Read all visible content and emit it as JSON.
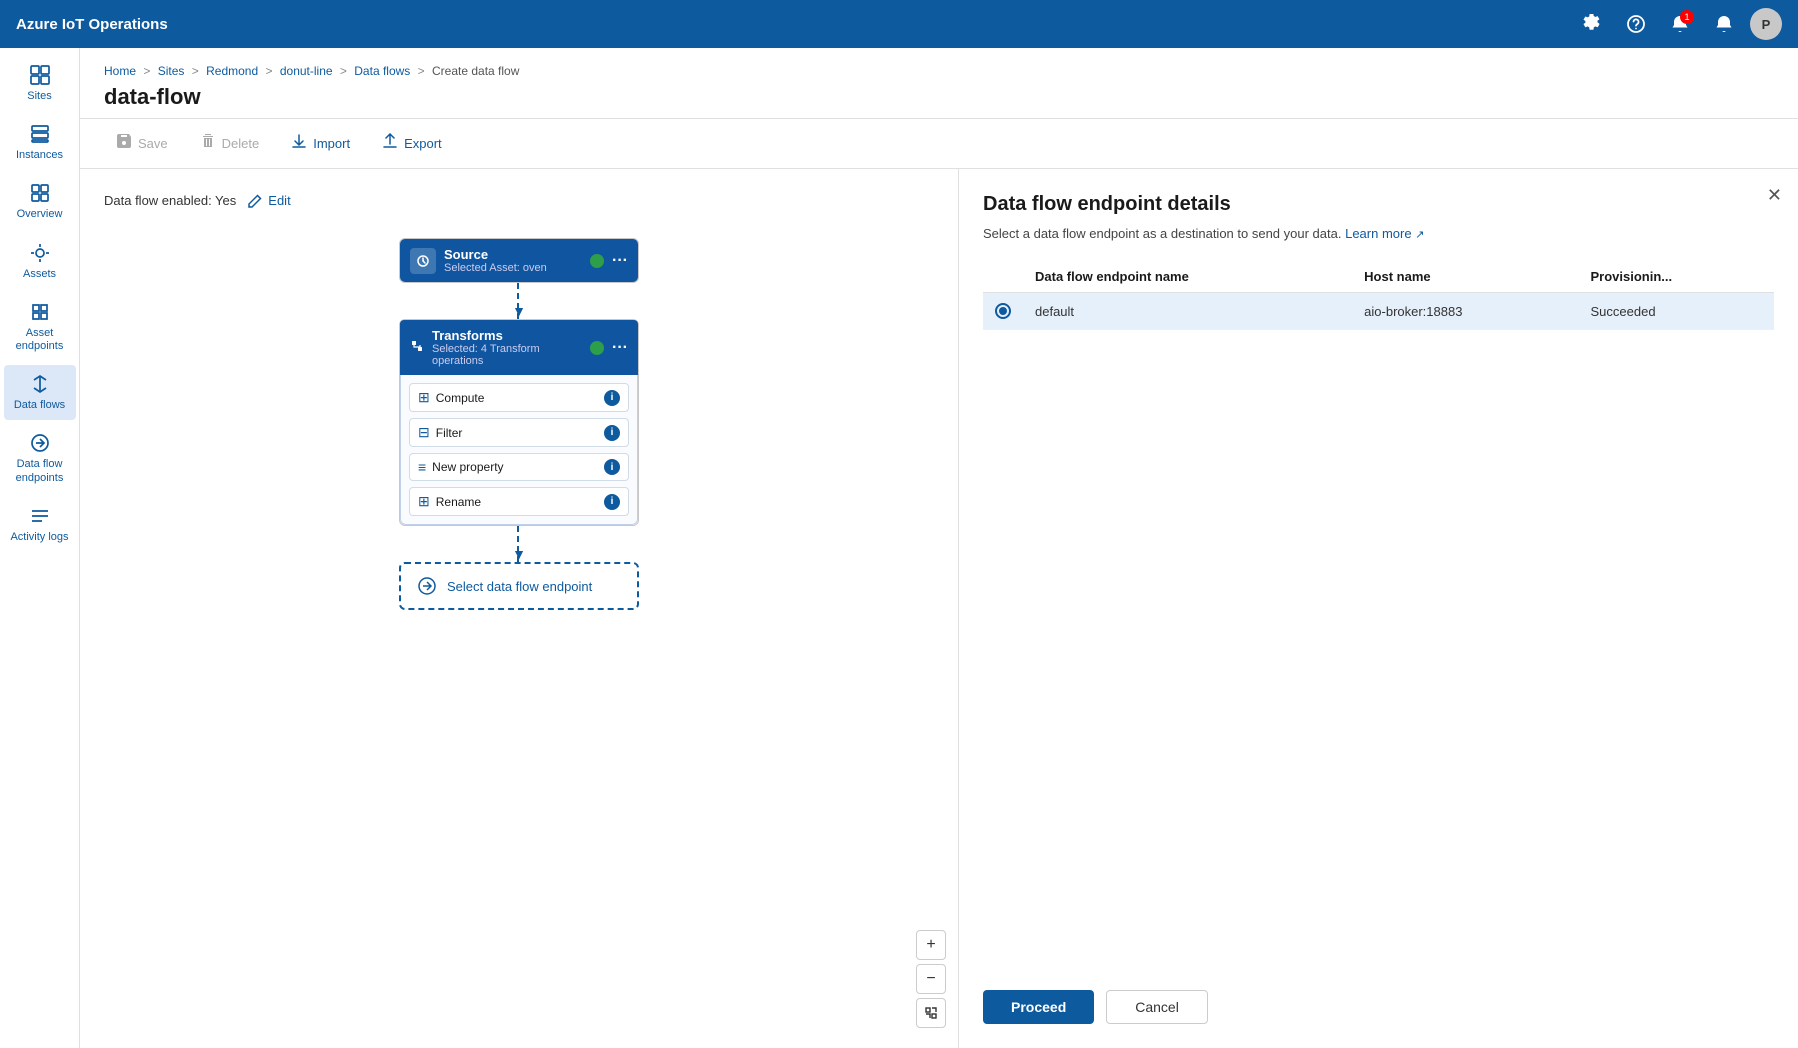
{
  "app": {
    "title": "Azure IoT Operations"
  },
  "header": {
    "icons": {
      "settings": "⚙",
      "help": "?",
      "bell": "🔔",
      "bell_badge": "1",
      "alert": "🔔",
      "avatar": "P"
    }
  },
  "breadcrumb": {
    "items": [
      "Home",
      "Sites",
      "Redmond",
      "donut-line",
      "Data flows",
      "Create data flow"
    ]
  },
  "page_title": "data-flow",
  "toolbar": {
    "save_label": "Save",
    "delete_label": "Delete",
    "import_label": "Import",
    "export_label": "Export"
  },
  "sidebar": {
    "items": [
      {
        "id": "sites",
        "label": "Sites",
        "icon": "grid"
      },
      {
        "id": "instances",
        "label": "Instances",
        "icon": "instances"
      },
      {
        "id": "overview",
        "label": "Overview",
        "icon": "overview"
      },
      {
        "id": "assets",
        "label": "Assets",
        "icon": "assets"
      },
      {
        "id": "asset-endpoints",
        "label": "Asset endpoints",
        "icon": "endpoints"
      },
      {
        "id": "data-flows",
        "label": "Data flows",
        "icon": "dataflows"
      },
      {
        "id": "data-flow-endpoints",
        "label": "Data flow endpoints",
        "icon": "dfendpoints"
      },
      {
        "id": "activity-logs",
        "label": "Activity logs",
        "icon": "activitylogs"
      }
    ]
  },
  "flow": {
    "enabled_label": "Data flow enabled: Yes",
    "edit_label": "Edit",
    "source_node": {
      "title": "Source",
      "subtitle": "Selected Asset: oven"
    },
    "transforms_node": {
      "title": "Transforms",
      "subtitle": "Selected: 4 Transform operations",
      "items": [
        {
          "label": "Compute",
          "icon": "⊞"
        },
        {
          "label": "Filter",
          "icon": "⊟"
        },
        {
          "label": "New property",
          "icon": "≡"
        },
        {
          "label": "Rename",
          "icon": "⊞"
        }
      ]
    },
    "select_endpoint_label": "Select data flow endpoint"
  },
  "endpoint_panel": {
    "title": "Data flow endpoint details",
    "description": "Select a data flow endpoint as a destination to send your data.",
    "learn_more_label": "Learn more",
    "table": {
      "columns": [
        "",
        "Data flow endpoint name",
        "Host name",
        "Provisionin..."
      ],
      "rows": [
        {
          "selected": true,
          "name": "default",
          "host": "aio-broker:18883",
          "status": "Succeeded"
        }
      ]
    },
    "proceed_label": "Proceed",
    "cancel_label": "Cancel"
  }
}
